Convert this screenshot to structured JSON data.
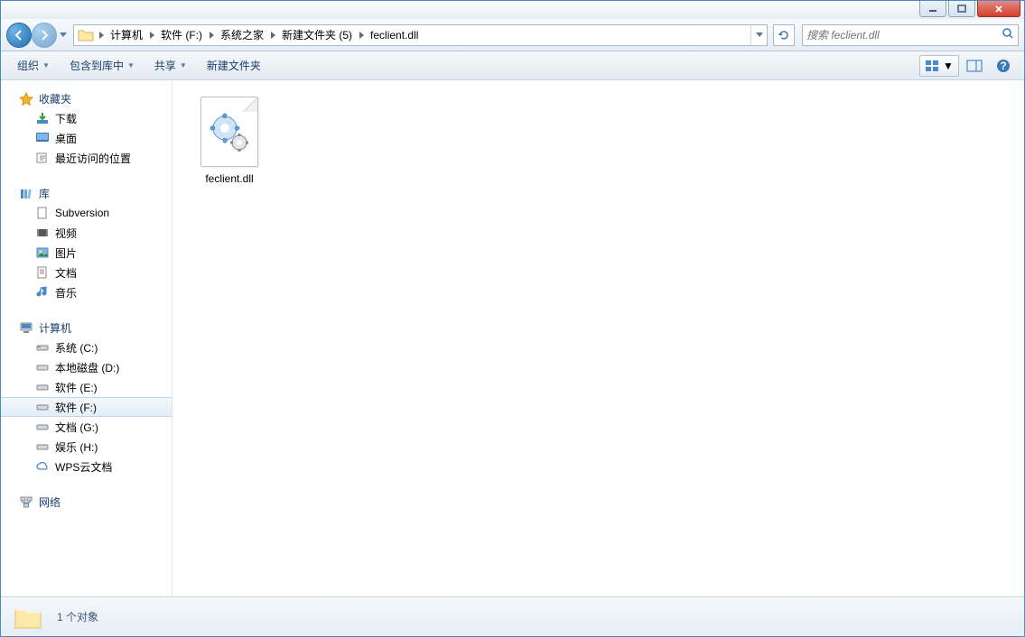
{
  "titlebar": {},
  "nav": {
    "breadcrumb": [
      "计算机",
      "软件 (F:)",
      "系统之家",
      "新建文件夹 (5)",
      "feclient.dll"
    ],
    "search_placeholder": "搜索 feclient.dll"
  },
  "toolbar": {
    "organize": "组织",
    "include": "包含到库中",
    "share": "共享",
    "newfolder": "新建文件夹"
  },
  "sidebar": {
    "favorites": {
      "label": "收藏夹",
      "items": [
        "下载",
        "桌面",
        "最近访问的位置"
      ]
    },
    "libraries": {
      "label": "库",
      "items": [
        "Subversion",
        "视频",
        "图片",
        "文档",
        "音乐"
      ]
    },
    "computer": {
      "label": "计算机",
      "items": [
        "系统 (C:)",
        "本地磁盘 (D:)",
        "软件 (E:)",
        "软件 (F:)",
        "文档 (G:)",
        "娱乐 (H:)",
        "WPS云文档"
      ],
      "selected": 3
    },
    "network": {
      "label": "网络"
    }
  },
  "content": {
    "files": [
      {
        "name": "feclient.dll"
      }
    ]
  },
  "status": {
    "text": "1 个对象"
  }
}
